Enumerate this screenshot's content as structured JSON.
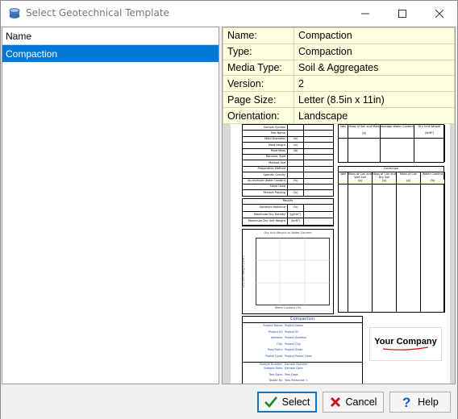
{
  "window": {
    "title": "Select Geotechnical Template"
  },
  "list": {
    "header": "Name",
    "items": [
      {
        "label": "Compaction",
        "selected": true
      }
    ]
  },
  "info": [
    {
      "key": "Name:",
      "value": "Compaction"
    },
    {
      "key": "Type:",
      "value": "Compaction"
    },
    {
      "key": "Media Type:",
      "value": "Soil & Aggregates"
    },
    {
      "key": "Version:",
      "value": "2"
    },
    {
      "key": "Page Size:",
      "value": "Letter (8.5in x 11in)"
    },
    {
      "key": "Orientation:",
      "value": "Landscape"
    }
  ],
  "preview": {
    "left_table_rows": [
      "Sample Symbol",
      "Test Name",
      "Mold Diameter",
      "Mold Height",
      "Mold Mass",
      "Rammer Type",
      "Method Use",
      "Preparation Method",
      "Specific Gravity",
      "As-received Water Content",
      "Sieve Used",
      "Percent Passing"
    ],
    "left_table_units": [
      "",
      "",
      "(in)",
      "(in)",
      "(lb)",
      "",
      "",
      "",
      "",
      "(%)",
      "",
      "(%)"
    ],
    "results_title": "Results",
    "results_rows": [
      {
        "label": "Optimum Moisture",
        "unit": "(%)"
      },
      {
        "label": "Maximum Dry Density",
        "unit": "(g/cm³)"
      },
      {
        "label": "Maximum Dry Unit Weight",
        "unit": "(lb/ft³)"
      }
    ],
    "chart_title": "Dry Unit Weight vs Water Content",
    "chart_ylabel": "Dry Unit Weight (lb/ft³)",
    "chart_xlabel": "Water Content (%)",
    "top_right_headers": [
      "Wet",
      "Mass of Soil and Mold",
      "Average Water Content",
      "Dry Unit Weight"
    ],
    "top_right_units": [
      "",
      "(g)",
      "",
      "(lb/ft³)"
    ],
    "correction_title": "Correction",
    "correction_headers": [
      "Wet",
      "Mass of Can and Wet Soil",
      "Mass of Can and Dry Soil",
      "Mass of Can",
      "Water Content"
    ],
    "correction_units": [
      "",
      "(g)",
      "(g)",
      "(g)",
      "(%)"
    ],
    "compaction_title": "Compaction",
    "compaction_fields": [
      {
        "label": "Project Name:",
        "value": "Project Name"
      },
      {
        "label": "Project ID:",
        "value": "Project ID"
      },
      {
        "label": "Address:",
        "value": "Project Address"
      },
      {
        "label": "City:",
        "value": "Project City"
      },
      {
        "label": "Prov/State:",
        "value": "Project State"
      },
      {
        "label": "Postal Code:",
        "value": "Project Postal Code"
      },
      {
        "label": "Sample Number:",
        "value": "Sample Number"
      },
      {
        "label": "Sample Date:",
        "value": "Sample Date"
      },
      {
        "label": "Test Date:",
        "value": "Test Date"
      },
      {
        "label": "Tested By:",
        "value": "Test Personnel 1"
      }
    ],
    "logo_text": "Your Company"
  },
  "buttons": {
    "select": "Select",
    "cancel": "Cancel",
    "help": "Help"
  }
}
